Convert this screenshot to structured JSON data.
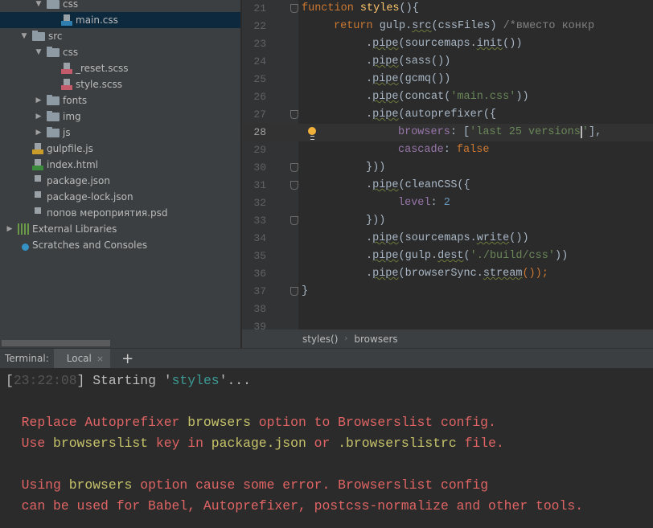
{
  "project_tree": [
    {
      "label": "css",
      "type": "folder",
      "depth": 2,
      "expanded": true
    },
    {
      "label": "main.css",
      "type": "css",
      "depth": 3,
      "selected": true
    },
    {
      "label": "src",
      "type": "folder",
      "depth": 1,
      "expanded": true
    },
    {
      "label": "css",
      "type": "folder",
      "depth": 2,
      "expanded": true
    },
    {
      "label": "_reset.scss",
      "type": "sass",
      "depth": 3
    },
    {
      "label": "style.scss",
      "type": "sass",
      "depth": 3
    },
    {
      "label": "fonts",
      "type": "folder",
      "depth": 2,
      "expanded": false
    },
    {
      "label": "img",
      "type": "folder",
      "depth": 2,
      "expanded": false
    },
    {
      "label": "js",
      "type": "folder",
      "depth": 2,
      "expanded": false
    },
    {
      "label": "gulpfile.js",
      "type": "js",
      "depth": 1
    },
    {
      "label": "index.html",
      "type": "html",
      "depth": 1
    },
    {
      "label": "package.json",
      "type": "json",
      "depth": 1
    },
    {
      "label": "package-lock.json",
      "type": "json",
      "depth": 1
    },
    {
      "label": "попов мероприятия.psd",
      "type": "image",
      "depth": 1
    },
    {
      "label": "External Libraries",
      "type": "libraries",
      "depth": 0,
      "expanded": false
    },
    {
      "label": "Scratches and Consoles",
      "type": "scratches",
      "depth": 0
    }
  ],
  "editor": {
    "current_line": 28,
    "lines": [
      {
        "n": "21",
        "indent": 0,
        "fold": true,
        "tokens": [
          [
            "function ",
            "kw"
          ],
          [
            "styles",
            "fn"
          ],
          [
            "(){",
            ""
          ]
        ]
      },
      {
        "n": "22",
        "indent": 1,
        "tokens": [
          [
            "return ",
            "kw"
          ],
          [
            "gulp.",
            ""
          ],
          [
            "src",
            "und"
          ],
          [
            "(cssFiles) ",
            ""
          ],
          [
            "/*вместо конкр",
            "cm"
          ]
        ]
      },
      {
        "n": "23",
        "indent": 2,
        "tokens": [
          [
            ".",
            ""
          ],
          [
            "pipe",
            "und"
          ],
          [
            "(sourcemaps.",
            ""
          ],
          [
            "init",
            "und"
          ],
          [
            "())",
            ""
          ]
        ]
      },
      {
        "n": "24",
        "indent": 2,
        "tokens": [
          [
            ".",
            ""
          ],
          [
            "pipe",
            "und"
          ],
          [
            "(sass())",
            ""
          ]
        ]
      },
      {
        "n": "25",
        "indent": 2,
        "tokens": [
          [
            ".",
            ""
          ],
          [
            "pipe",
            "und"
          ],
          [
            "(gcmq())",
            ""
          ]
        ]
      },
      {
        "n": "26",
        "indent": 2,
        "tokens": [
          [
            ".",
            ""
          ],
          [
            "pipe",
            "und"
          ],
          [
            "(concat(",
            ""
          ],
          [
            "'main.css'",
            "str"
          ],
          [
            "))",
            ""
          ]
        ]
      },
      {
        "n": "27",
        "indent": 2,
        "fold": true,
        "tokens": [
          [
            ".",
            ""
          ],
          [
            "pipe",
            "und"
          ],
          [
            "(autoprefixer({",
            ""
          ]
        ]
      },
      {
        "n": "28",
        "indent": 3,
        "bulb": true,
        "tokens": [
          [
            "browsers",
            "prop"
          ],
          [
            ": [",
            ""
          ],
          [
            "'last 25 versions",
            "str"
          ],
          [
            "'",
            "str caret"
          ],
          [
            "],",
            ""
          ]
        ]
      },
      {
        "n": "29",
        "indent": 3,
        "tokens": [
          [
            "cascade",
            "prop"
          ],
          [
            ": ",
            ""
          ],
          [
            "false",
            "kw"
          ]
        ]
      },
      {
        "n": "30",
        "indent": 2,
        "fold": true,
        "tokens": [
          [
            "}))",
            ""
          ]
        ]
      },
      {
        "n": "31",
        "indent": 2,
        "fold": true,
        "tokens": [
          [
            ".",
            ""
          ],
          [
            "pipe",
            "und"
          ],
          [
            "(cleanCSS({",
            ""
          ]
        ]
      },
      {
        "n": "32",
        "indent": 3,
        "tokens": [
          [
            "level",
            "prop"
          ],
          [
            ": ",
            ""
          ],
          [
            "2",
            "num"
          ]
        ]
      },
      {
        "n": "33",
        "indent": 2,
        "fold": true,
        "tokens": [
          [
            "}))",
            ""
          ]
        ]
      },
      {
        "n": "34",
        "indent": 2,
        "tokens": [
          [
            ".",
            ""
          ],
          [
            "pipe",
            "und"
          ],
          [
            "(sourcemaps.",
            ""
          ],
          [
            "write",
            "und"
          ],
          [
            "())",
            ""
          ]
        ]
      },
      {
        "n": "35",
        "indent": 2,
        "tokens": [
          [
            ".",
            ""
          ],
          [
            "pipe",
            "und"
          ],
          [
            "(gulp.",
            ""
          ],
          [
            "dest",
            "und"
          ],
          [
            "(",
            ""
          ],
          [
            "'./build/css'",
            "str"
          ],
          [
            "))",
            ""
          ]
        ]
      },
      {
        "n": "36",
        "indent": 2,
        "tokens": [
          [
            ".",
            ""
          ],
          [
            "pipe",
            "und"
          ],
          [
            "(browserSync.",
            ""
          ],
          [
            "stream",
            "und"
          ],
          [
            "());",
            "kw"
          ]
        ]
      },
      {
        "n": "37",
        "indent": 0,
        "fold": true,
        "tokens": [
          [
            "}",
            ""
          ]
        ]
      },
      {
        "n": "38",
        "indent": 0,
        "tokens": []
      },
      {
        "n": "39",
        "indent": 0,
        "tokens": []
      }
    ]
  },
  "breadcrumbs": [
    "styles()",
    "browsers"
  ],
  "terminal": {
    "label": "Terminal:",
    "tab": "Local",
    "close": "×",
    "add": "+",
    "lines": [
      {
        "row": 0,
        "tokens": [
          [
            "[",
            ""
          ],
          [
            "23:22:08",
            "t-dim"
          ],
          [
            "] Starting '",
            ""
          ],
          [
            "styles",
            "t-cy"
          ],
          [
            "'...",
            ""
          ]
        ]
      },
      {
        "row": 2,
        "tokens": [
          [
            "  Replace Autoprefixer ",
            "t-red"
          ],
          [
            "browsers",
            "t-yel"
          ],
          [
            " option to Browserslist config.",
            "t-red"
          ]
        ]
      },
      {
        "row": 3,
        "tokens": [
          [
            "  Use ",
            "t-red"
          ],
          [
            "browserslist",
            "t-yel"
          ],
          [
            " key in ",
            "t-red"
          ],
          [
            "package.json",
            "t-yel"
          ],
          [
            " or ",
            "t-red"
          ],
          [
            ".browserslistrc",
            "t-yel"
          ],
          [
            " file.",
            "t-red"
          ]
        ]
      },
      {
        "row": 5,
        "tokens": [
          [
            "  Using ",
            "t-red"
          ],
          [
            "browsers",
            "t-yel"
          ],
          [
            " option cause some error. Browserslist config",
            "t-red"
          ]
        ]
      },
      {
        "row": 6,
        "tokens": [
          [
            "  can be used for Babel, Autoprefixer, postcss-normalize and other tools.",
            "t-red"
          ]
        ]
      }
    ]
  },
  "colors": {
    "sidebar_bg": "#3c3f41",
    "editor_bg": "#2b2b2b",
    "selection": "#0d293e",
    "error_red": "#e06464",
    "highlight_yellow": "#c6c36a"
  }
}
